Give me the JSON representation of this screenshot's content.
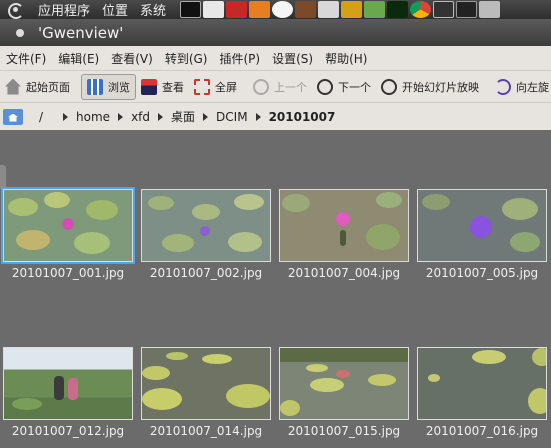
{
  "gnome_panel": {
    "menus": [
      "应用程序",
      "位置",
      "系统"
    ]
  },
  "window": {
    "title": "'Gwenview'"
  },
  "menubar": {
    "items": [
      "文件(F)",
      "编辑(E)",
      "查看(V)",
      "转到(G)",
      "插件(P)",
      "设置(S)",
      "帮助(H)"
    ]
  },
  "toolbar": {
    "start_page": "起始页面",
    "browse": "浏览",
    "view": "查看",
    "fullscreen": "全屏",
    "previous": "上一个",
    "next": "下一个",
    "slideshow": "开始幻灯片放映",
    "rotate_left": "向左旋"
  },
  "breadcrumb": {
    "root": "/",
    "items": [
      "home",
      "xfd",
      "桌面",
      "DCIM",
      "20101007"
    ]
  },
  "thumbnails": [
    {
      "name": "20101007_001.jpg",
      "selected": true
    },
    {
      "name": "20101007_002.jpg",
      "selected": false
    },
    {
      "name": "20101007_004.jpg",
      "selected": false
    },
    {
      "name": "20101007_005.jpg",
      "selected": false
    },
    {
      "name": "20101007_012.jpg",
      "selected": false
    },
    {
      "name": "20101007_014.jpg",
      "selected": false
    },
    {
      "name": "20101007_015.jpg",
      "selected": false
    },
    {
      "name": "20101007_016.jpg",
      "selected": false
    }
  ],
  "colors": {
    "selection": "#49a6ef",
    "view_background": "#6b6b6b",
    "chrome": "#e7e4df"
  }
}
